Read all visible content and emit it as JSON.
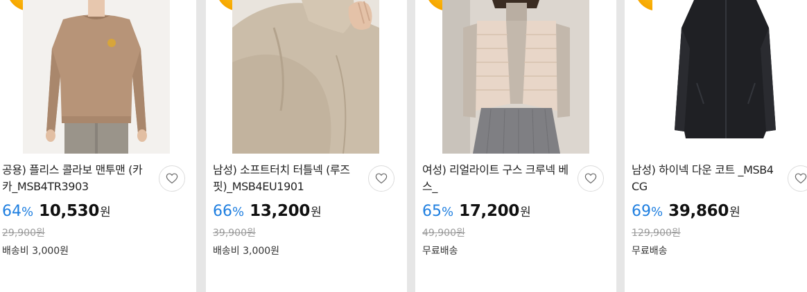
{
  "colors": {
    "discount": "#1f7fe0",
    "badge": "#f7a800",
    "background": "#e6e6e6"
  },
  "products": [
    {
      "title": "공용) 플리스 콜라보 맨투맨 (카카_MSB4TR3903",
      "discount": "64",
      "percent_sign": "%",
      "price": "10,530",
      "currency": "원",
      "original_price": "29,900원",
      "shipping": "배송비 3,000원",
      "wishlist_icon": "heart-outline-icon"
    },
    {
      "title": "남성) 소프트터치 터틀넥 (루즈핏)_MSB4EU1901",
      "discount": "66",
      "percent_sign": "%",
      "price": "13,200",
      "currency": "원",
      "original_price": "39,900원",
      "shipping": "배송비 3,000원",
      "wishlist_icon": "heart-outline-icon"
    },
    {
      "title": "여성) 리얼라이트 구스 크루넥 베스_",
      "discount": "65",
      "percent_sign": "%",
      "price": "17,200",
      "currency": "원",
      "original_price": "49,900원",
      "shipping": "무료배송",
      "wishlist_icon": "heart-outline-icon"
    },
    {
      "title": "남성) 하이넥 다운 코트 _MSB4CG",
      "discount": "69",
      "percent_sign": "%",
      "price": "39,860",
      "currency": "원",
      "original_price": "129,900원",
      "shipping": "무료배송",
      "wishlist_icon": "heart-outline-icon"
    }
  ]
}
